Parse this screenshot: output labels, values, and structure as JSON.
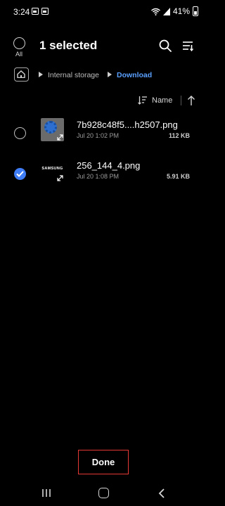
{
  "status_bar": {
    "time": "3:24",
    "battery": "41%",
    "icons": [
      "gallery-notification-icon",
      "gallery-notification-icon",
      "wifi-icon",
      "signal-icon",
      "battery-icon"
    ]
  },
  "header": {
    "select_all_label": "All",
    "title": "1 selected"
  },
  "breadcrumb": {
    "items": [
      "Internal storage",
      "Download"
    ]
  },
  "sort": {
    "label": "Name"
  },
  "files": [
    {
      "name": "7b928c48f5....h2507.png",
      "date": "Jul 20 1:02 PM",
      "size": "112 KB",
      "selected": false
    },
    {
      "name": "256_144_4.png",
      "date": "Jul 20 1:08 PM",
      "size": "5.91 KB",
      "selected": true,
      "thumb_text": "SAMSUNG"
    }
  ],
  "actions": {
    "done_label": "Done"
  },
  "colors": {
    "accent": "#3f7df7",
    "breadcrumb_active": "#5aa0ff",
    "highlight_border": "#e53935"
  }
}
